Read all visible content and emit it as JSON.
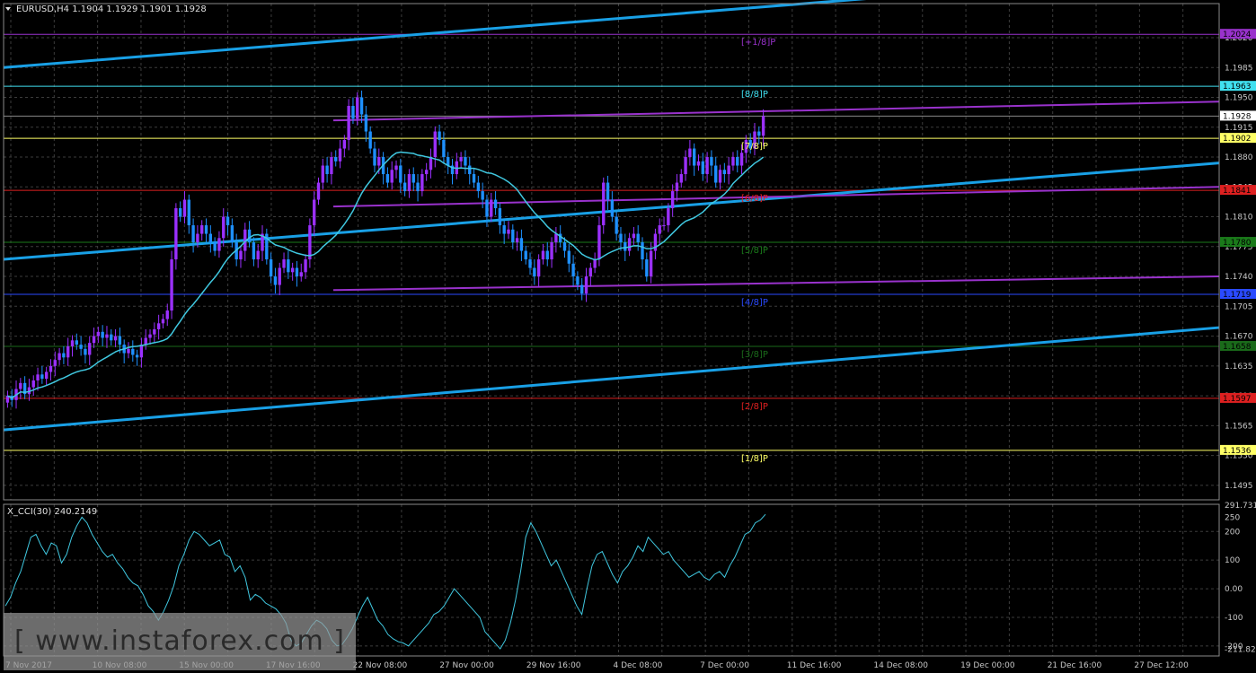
{
  "header": {
    "symbol_line": "EURUSD,H4  1.1904 1.1929 1.1901 1.1928"
  },
  "indicator": {
    "label": "X_CCI(30) 240.2149"
  },
  "watermark": {
    "text": "[ www.instaforex.com ]"
  },
  "colors": {
    "background": "#000000",
    "grid": "#3c3c3c",
    "bull_candle": "#9b30ff",
    "bear_candle": "#1e90ff",
    "ma_line": "#40c8e0",
    "trend_line": "#19a0e6",
    "murrey_purple": "#9932cc",
    "cci_line": "#40c8e0"
  },
  "chart_data": [
    {
      "type": "candlestick",
      "title": "EURUSD,H4",
      "ylim": [
        1.1478,
        1.206
      ],
      "y_ticks": [
        "1.1495",
        "1.1530",
        "1.1565",
        "1.1600",
        "1.1635",
        "1.1670",
        "1.1705",
        "1.1740",
        "1.1775",
        "1.1810",
        "1.1845",
        "1.1880",
        "1.1915",
        "1.1950",
        "1.1985",
        "1.2020"
      ],
      "x_labels": [
        "7 Nov 2017",
        "10 Nov 08:00",
        "15 Nov 00:00",
        "17 Nov 16:00",
        "22 Nov 08:00",
        "27 Nov 00:00",
        "29 Nov 16:00",
        "4 Dec 08:00",
        "7 Dec 00:00",
        "11 Dec 16:00",
        "14 Dec 08:00",
        "19 Dec 00:00",
        "21 Dec 16:00",
        "27 Dec 12:00"
      ],
      "last_price": 1.1928,
      "price_tags": [
        {
          "text": "1.2024",
          "value": 1.2024,
          "color": "#9932cc"
        },
        {
          "text": "1.1963",
          "value": 1.1963,
          "color": "#40e0f0"
        },
        {
          "text": "1.1928",
          "value": 1.1928,
          "color": "#ffffff"
        },
        {
          "text": "1.1902",
          "value": 1.1902,
          "color": "#ffff66"
        },
        {
          "text": "1.1841",
          "value": 1.1841,
          "color": "#dd2020"
        },
        {
          "text": "1.1780",
          "value": 1.178,
          "color": "#1a7a1a"
        },
        {
          "text": "1.1719",
          "value": 1.1719,
          "color": "#2a4aff"
        },
        {
          "text": "1.1658",
          "value": 1.1658,
          "color": "#1a6a1a"
        },
        {
          "text": "1.1597",
          "value": 1.1597,
          "color": "#dd2020"
        },
        {
          "text": "1.1536",
          "value": 1.1536,
          "color": "#ffff66"
        }
      ],
      "murrey_labels": [
        {
          "text": "[+1/8]P",
          "value": 1.2024,
          "color": "#9932cc"
        },
        {
          "text": "[8/8]P",
          "value": 1.1963,
          "color": "#40e0f0"
        },
        {
          "text": "[7/8]P",
          "value": 1.1902,
          "color": "#ffff66"
        },
        {
          "text": "[6/8]P",
          "value": 1.1841,
          "color": "#dd2020"
        },
        {
          "text": "[5/8]P",
          "value": 1.178,
          "color": "#1a7a1a"
        },
        {
          "text": "[4/8]P",
          "value": 1.1719,
          "color": "#2a4aff"
        },
        {
          "text": "[3/8]P",
          "value": 1.1658,
          "color": "#1a6a1a"
        },
        {
          "text": "[2/8]P",
          "value": 1.1597,
          "color": "#dd2020"
        },
        {
          "text": "[1/8]P",
          "value": 1.1536,
          "color": "#ffff66"
        }
      ],
      "close": [
        1.16,
        1.1595,
        1.1608,
        1.1615,
        1.1602,
        1.161,
        1.1618,
        1.1625,
        1.162,
        1.1628,
        1.1635,
        1.1642,
        1.165,
        1.1645,
        1.1658,
        1.1665,
        1.166,
        1.1655,
        1.1648,
        1.1662,
        1.167,
        1.1675,
        1.1668,
        1.1672,
        1.1665,
        1.167,
        1.166,
        1.165,
        1.1655,
        1.1648,
        1.1645,
        1.166,
        1.1668,
        1.1672,
        1.1678,
        1.1685,
        1.169,
        1.17,
        1.176,
        1.182,
        1.181,
        1.183,
        1.18,
        1.178,
        1.179,
        1.18,
        1.179,
        1.178,
        1.177,
        1.1785,
        1.181,
        1.18,
        1.178,
        1.176,
        1.177,
        1.1795,
        1.178,
        1.176,
        1.177,
        1.179,
        1.176,
        1.174,
        1.173,
        1.175,
        1.176,
        1.1745,
        1.175,
        1.174,
        1.1745,
        1.176,
        1.18,
        1.183,
        1.185,
        1.187,
        1.186,
        1.188,
        1.1875,
        1.189,
        1.19,
        1.194,
        1.1925,
        1.195,
        1.193,
        1.191,
        1.189,
        1.187,
        1.188,
        1.186,
        1.185,
        1.1865,
        1.187,
        1.185,
        1.184,
        1.186,
        1.185,
        1.184,
        1.186,
        1.1865,
        1.188,
        1.191,
        1.19,
        1.188,
        1.187,
        1.186,
        1.1875,
        1.188,
        1.187,
        1.186,
        1.185,
        1.184,
        1.183,
        1.181,
        1.183,
        1.182,
        1.18,
        1.179,
        1.1795,
        1.178,
        1.1785,
        1.177,
        1.176,
        1.175,
        1.174,
        1.176,
        1.177,
        1.176,
        1.178,
        1.179,
        1.178,
        1.177,
        1.1755,
        1.174,
        1.173,
        1.172,
        1.174,
        1.175,
        1.176,
        1.18,
        1.185,
        1.183,
        1.181,
        1.179,
        1.178,
        1.177,
        1.1785,
        1.179,
        1.178,
        1.176,
        1.174,
        1.177,
        1.179,
        1.18,
        1.18,
        1.182,
        1.184,
        1.185,
        1.186,
        1.188,
        1.189,
        1.187,
        1.1875,
        1.186,
        1.188,
        1.187,
        1.185,
        1.1865,
        1.186,
        1.187,
        1.188,
        1.187,
        1.1885,
        1.19,
        1.189,
        1.191,
        1.1905,
        1.1928
      ]
    },
    {
      "type": "line",
      "title": "X_CCI(30)",
      "ylim": [
        -235,
        295
      ],
      "y_ticks": [
        "291.7312",
        "250",
        "200",
        "100",
        "0.00",
        "-100",
        "-200",
        "-211.827"
      ],
      "values": [
        -60,
        -30,
        20,
        60,
        120,
        180,
        190,
        150,
        120,
        160,
        150,
        90,
        120,
        180,
        220,
        250,
        230,
        190,
        160,
        130,
        110,
        120,
        90,
        70,
        40,
        20,
        10,
        -20,
        -60,
        -80,
        -110,
        -80,
        -40,
        10,
        80,
        120,
        170,
        200,
        190,
        170,
        150,
        160,
        170,
        120,
        110,
        60,
        80,
        40,
        -40,
        -20,
        -30,
        -50,
        -60,
        -70,
        -90,
        -120,
        -180,
        -200,
        -190,
        -160,
        -130,
        -110,
        -120,
        -140,
        -180,
        -200,
        -195,
        -170,
        -140,
        -100,
        -60,
        -30,
        -70,
        -110,
        -130,
        -160,
        -175,
        -185,
        -190,
        -200,
        -180,
        -160,
        -140,
        -120,
        -90,
        -80,
        -60,
        -30,
        0,
        -20,
        -40,
        -60,
        -80,
        -100,
        -150,
        -170,
        -190,
        -210,
        -180,
        -120,
        -40,
        60,
        180,
        230,
        200,
        160,
        120,
        80,
        100,
        60,
        20,
        -20,
        -60,
        -90,
        0,
        80,
        120,
        130,
        90,
        50,
        20,
        60,
        80,
        110,
        150,
        130,
        180,
        160,
        140,
        120,
        130,
        100,
        80,
        60,
        40,
        50,
        60,
        40,
        30,
        50,
        60,
        40,
        80,
        110,
        150,
        190,
        200,
        230,
        240,
        260
      ]
    }
  ]
}
